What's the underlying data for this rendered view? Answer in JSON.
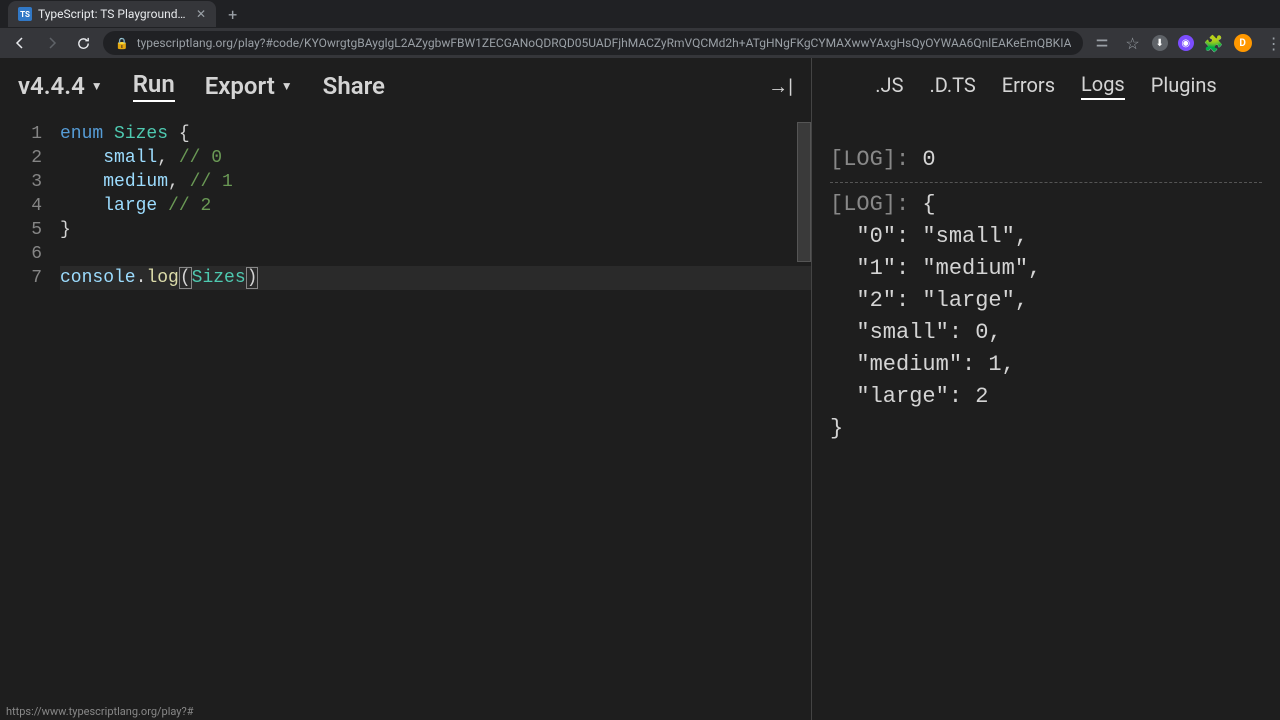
{
  "browser": {
    "tab_title": "TypeScript: TS Playground - A",
    "url": "typescriptlang.org/play?#code/KYOwrgtgBAyglgL2AZygbwFBW1ZECGANoQDRQD05UADFjhMACZyRmVQCMd2h+ATgHNgFKgCYMAXwwYAxgHsQyOYWAA6QnlEAKeEmQBKIA",
    "avatar_letter": "D"
  },
  "toolbar": {
    "version": "v4.4.4",
    "run": "Run",
    "export": "Export",
    "share": "Share"
  },
  "editor": {
    "lines": [
      {
        "n": "1",
        "tokens": [
          {
            "t": "enum ",
            "c": "kw"
          },
          {
            "t": "Sizes",
            "c": "type"
          },
          {
            "t": " {",
            "c": ""
          }
        ]
      },
      {
        "n": "2",
        "tokens": [
          {
            "t": "    ",
            "c": ""
          },
          {
            "t": "small",
            "c": "ident"
          },
          {
            "t": ", ",
            "c": ""
          },
          {
            "t": "// 0",
            "c": "comment"
          }
        ]
      },
      {
        "n": "3",
        "tokens": [
          {
            "t": "    ",
            "c": ""
          },
          {
            "t": "medium",
            "c": "ident"
          },
          {
            "t": ", ",
            "c": ""
          },
          {
            "t": "// 1",
            "c": "comment"
          }
        ]
      },
      {
        "n": "4",
        "tokens": [
          {
            "t": "    ",
            "c": ""
          },
          {
            "t": "large",
            "c": "ident"
          },
          {
            "t": " ",
            "c": ""
          },
          {
            "t": "// 2",
            "c": "comment"
          }
        ]
      },
      {
        "n": "5",
        "tokens": [
          {
            "t": "}",
            "c": ""
          }
        ]
      },
      {
        "n": "6",
        "tokens": []
      },
      {
        "n": "7",
        "cursor": true,
        "tokens": [
          {
            "t": "console",
            "c": "ident"
          },
          {
            "t": ".",
            "c": ""
          },
          {
            "t": "log",
            "c": "fn"
          },
          {
            "t": "(",
            "c": "bracket"
          },
          {
            "t": "Sizes",
            "c": "type"
          },
          {
            "t": ")",
            "c": "bracket"
          }
        ]
      }
    ]
  },
  "output_tabs": {
    "js": ".JS",
    "dts": ".D.TS",
    "errors": "Errors",
    "logs": "Logs",
    "plugins": "Plugins",
    "active": "logs"
  },
  "logs": [
    {
      "label": "[LOG]: ",
      "lines": [
        "0"
      ],
      "sep": true
    },
    {
      "label": "[LOG]: ",
      "lines": [
        "{",
        "  \"0\": \"small\",",
        "  \"1\": \"medium\",",
        "  \"2\": \"large\",",
        "  \"small\": 0,",
        "  \"medium\": 1,",
        "  \"large\": 2",
        "}"
      ],
      "sep": false
    }
  ],
  "status_url": "https://www.typescriptlang.org/play?#"
}
